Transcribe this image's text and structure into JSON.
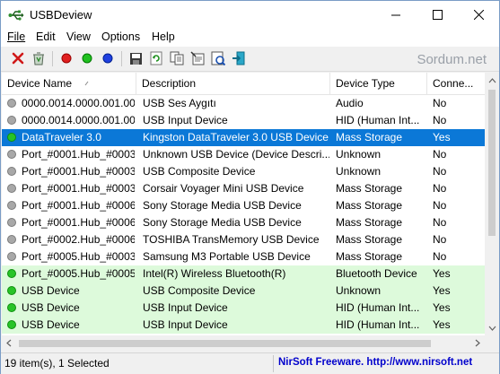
{
  "window": {
    "title": "USBDeview"
  },
  "menu": [
    {
      "id": "file",
      "label": "File"
    },
    {
      "id": "edit",
      "label": "Edit"
    },
    {
      "id": "view",
      "label": "View"
    },
    {
      "id": "options",
      "label": "Options"
    },
    {
      "id": "help",
      "label": "Help"
    }
  ],
  "watermark": "Sordum.net",
  "columns": [
    {
      "label": "Device Name"
    },
    {
      "label": "Description"
    },
    {
      "label": "Device Type"
    },
    {
      "label": "Conne..."
    }
  ],
  "rows": [
    {
      "name": "0000.0014.0000.001.00...",
      "description": "USB Ses Aygıtı",
      "type": "Audio",
      "connected": "No",
      "state": "gray"
    },
    {
      "name": "0000.0014.0000.001.00...",
      "description": "USB Input Device",
      "type": "HID (Human Int...",
      "connected": "No",
      "state": "gray"
    },
    {
      "name": "DataTraveler 3.0",
      "description": "Kingston DataTraveler 3.0 USB Device",
      "type": "Mass Storage",
      "connected": "Yes",
      "state": "green",
      "selected": true
    },
    {
      "name": "Port_#0001.Hub_#0003",
      "description": "Unknown USB Device (Device Descri...",
      "type": "Unknown",
      "connected": "No",
      "state": "gray"
    },
    {
      "name": "Port_#0001.Hub_#0003",
      "description": "USB Composite Device",
      "type": "Unknown",
      "connected": "No",
      "state": "gray"
    },
    {
      "name": "Port_#0001.Hub_#0003",
      "description": "Corsair Voyager Mini USB Device",
      "type": "Mass Storage",
      "connected": "No",
      "state": "gray"
    },
    {
      "name": "Port_#0001.Hub_#0006",
      "description": "Sony Storage Media USB Device",
      "type": "Mass Storage",
      "connected": "No",
      "state": "gray"
    },
    {
      "name": "Port_#0001.Hub_#0006",
      "description": "Sony Storage Media USB Device",
      "type": "Mass Storage",
      "connected": "No",
      "state": "gray"
    },
    {
      "name": "Port_#0002.Hub_#0006",
      "description": "TOSHIBA TransMemory USB Device",
      "type": "Mass Storage",
      "connected": "No",
      "state": "gray"
    },
    {
      "name": "Port_#0005.Hub_#0003",
      "description": "Samsung M3 Portable USB Device",
      "type": "Mass Storage",
      "connected": "No",
      "state": "gray"
    },
    {
      "name": "Port_#0005.Hub_#0005",
      "description": "Intel(R) Wireless Bluetooth(R)",
      "type": "Bluetooth Device",
      "connected": "Yes",
      "state": "green",
      "highlight": true
    },
    {
      "name": "USB Device",
      "description": "USB Composite Device",
      "type": "Unknown",
      "connected": "Yes",
      "state": "green",
      "highlight": true
    },
    {
      "name": "USB Device",
      "description": "USB Input Device",
      "type": "HID (Human Int...",
      "connected": "Yes",
      "state": "green",
      "highlight": true
    },
    {
      "name": "USB Device",
      "description": "USB Input Device",
      "type": "HID (Human Int...",
      "connected": "Yes",
      "state": "green",
      "highlight": true
    }
  ],
  "status": {
    "items": "19 item(s), 1 Selected",
    "credit": "NirSoft Freeware.  http://www.nirsoft.net"
  },
  "colors": {
    "selected": "#0b78d7",
    "connected_row": "#ddfadb",
    "credit": "#0000cc"
  }
}
